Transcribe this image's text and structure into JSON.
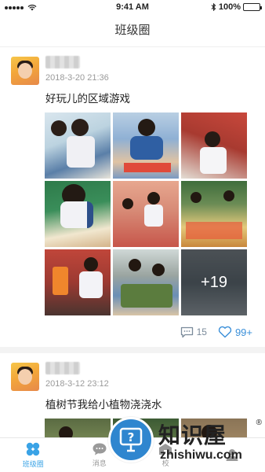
{
  "status_bar": {
    "time": "9:41 AM",
    "battery": "100%"
  },
  "nav": {
    "title": "班级圈"
  },
  "posts": [
    {
      "timestamp": "2018-3-20 21:36",
      "text": "好玩儿的区域游戏",
      "more_photos": "+19",
      "comments": "15",
      "likes": "99+"
    },
    {
      "timestamp": "2018-3-12 23:12",
      "text": "植树节我给小植物浇浇水"
    }
  ],
  "tabs": [
    {
      "label": "班级圈",
      "icon": "class-circle-icon",
      "active": true
    },
    {
      "label": "消息",
      "icon": "message-icon",
      "active": false
    },
    {
      "label": "校",
      "icon": "school-icon",
      "active": false
    },
    {
      "label": "",
      "icon": "profile-icon",
      "active": false
    }
  ],
  "watermark": {
    "title": "知识屋",
    "url": "zhishiwu.com",
    "reg": "®"
  },
  "colors": {
    "accent": "#3aa3e6",
    "like": "#3a8fd9"
  }
}
